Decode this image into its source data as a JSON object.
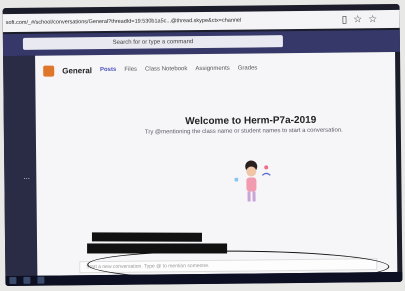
{
  "browser": {
    "url": "soft.com/_#/school/conversations/General?threadId=19:530b1a5c...@thread.skype&ctx=channel",
    "icons": [
      "reader-icon",
      "star-icon",
      "favorites-icon"
    ]
  },
  "teams": {
    "search_placeholder": "Search for or type a command",
    "channel": "General",
    "tabs": [
      {
        "label": "Posts",
        "active": true
      },
      {
        "label": "Files",
        "active": false
      },
      {
        "label": "Class Notebook",
        "active": false
      },
      {
        "label": "Assignments",
        "active": false
      },
      {
        "label": "Grades",
        "active": false
      }
    ],
    "welcome_title": "Welcome to Herm-P7a-2019",
    "welcome_hint": "Try @mentioning the class name or student names to start a conversation.",
    "compose_placeholder": "Start a new conversation. Type @ to mention someone.",
    "rail_more": "..."
  },
  "colors": {
    "teams_header": "#353868",
    "accent": "#4b53bc",
    "team_avatar": "#e0762b"
  }
}
